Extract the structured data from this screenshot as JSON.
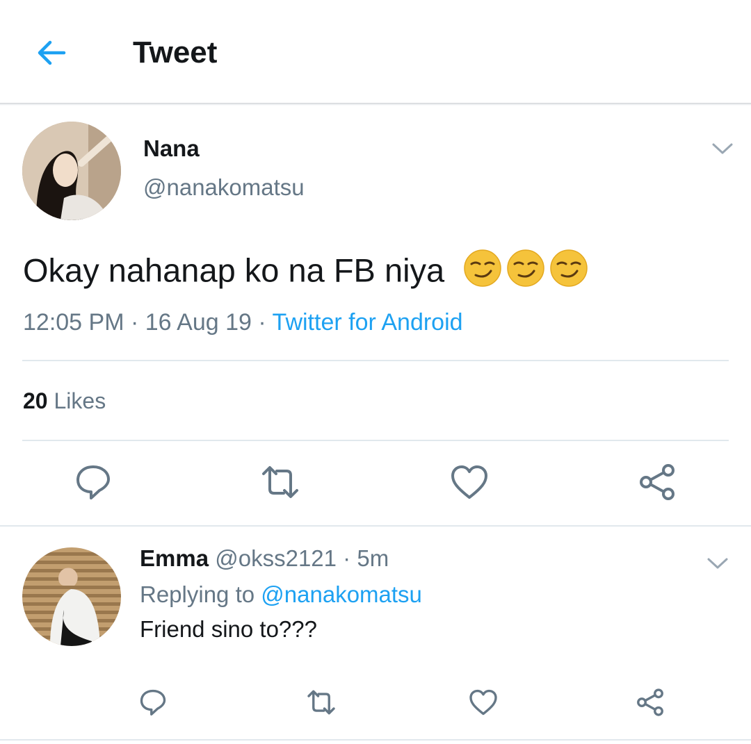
{
  "header": {
    "title": "Tweet",
    "back_icon": "arrow-left-icon",
    "accent": "#1da1f2"
  },
  "tweet": {
    "author_name": "Nana",
    "author_handle": "@nanakomatsu",
    "text": "Okay nahanap ko na FB niya",
    "emojis": [
      "smirking-face",
      "smirking-face",
      "smirking-face"
    ],
    "time": "12:05 PM",
    "date": "16 Aug 19",
    "sep": "·",
    "source": "Twitter for Android",
    "likes_count": "20",
    "likes_label": "Likes",
    "actions": [
      "reply-icon",
      "retweet-icon",
      "like-icon",
      "share-icon"
    ]
  },
  "reply": {
    "author_name": "Emma",
    "author_handle": "@okss2121",
    "sep": "·",
    "age": "5m",
    "replying_prefix": "Replying to",
    "replying_mention": "@nanakomatsu",
    "text": "Friend sino to???",
    "actions": [
      "reply-icon",
      "retweet-icon",
      "like-icon",
      "share-icon"
    ]
  },
  "colors": {
    "text": "#14171a",
    "secondary": "#657786",
    "link": "#1da1f2",
    "divider": "#e1e8ed",
    "emoji": "#f5c33b"
  }
}
